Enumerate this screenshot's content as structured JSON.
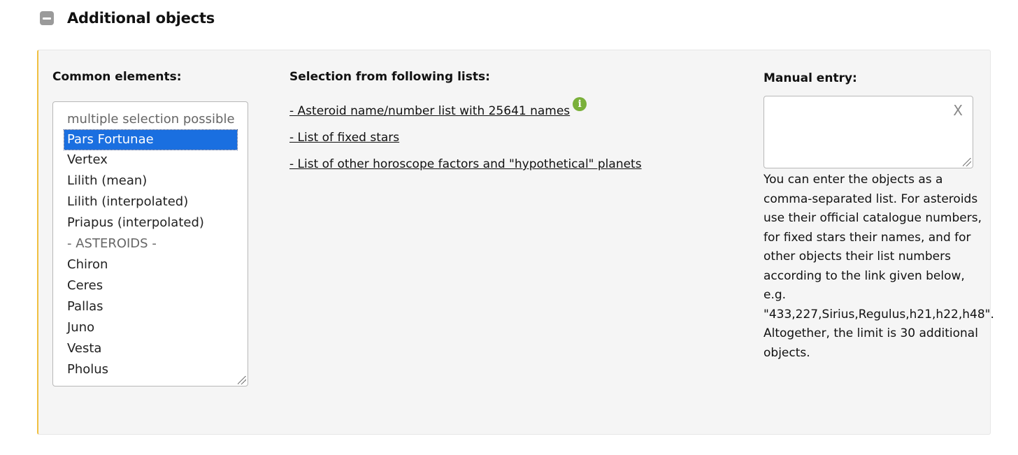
{
  "section": {
    "title": "Additional objects",
    "collapse_icon": "minus-square-icon"
  },
  "common": {
    "title": "Common elements:",
    "placeholder": "multiple selection possible",
    "selected": "Pars Fortunae",
    "options": [
      "Vertex",
      "Lilith (mean)",
      "Lilith (interpolated)",
      "Priapus (interpolated)"
    ],
    "group_label": "- ASTEROIDS -",
    "asteroids": [
      "Chiron",
      "Ceres",
      "Pallas",
      "Juno",
      "Vesta",
      "Pholus"
    ]
  },
  "lists": {
    "title": "Selection from following lists:",
    "asteroid_link": "- Asteroid name/number list with 25641 names",
    "fixed_stars_link": "- List of fixed stars",
    "other_link": "- List of other horoscope factors and \"hypothetical\" planets",
    "info_icon": "info-circle-icon"
  },
  "manual": {
    "title": "Manual entry:",
    "value": "",
    "clear_label": "X",
    "help": "You can enter the objects as a comma-separated list. For asteroids use their official catalogue numbers, for fixed stars their names, and for other objects their list numbers according to the link given below, e.g. \"433,227,Sirius,Regulus,h21,h22,h48\". Altogether, the limit is 30 additional objects."
  },
  "colors": {
    "selection": "#1a6fe0",
    "panel_bg": "#f5f5f5",
    "panel_accent": "#f0c040",
    "info_icon": "#7ab03a"
  }
}
